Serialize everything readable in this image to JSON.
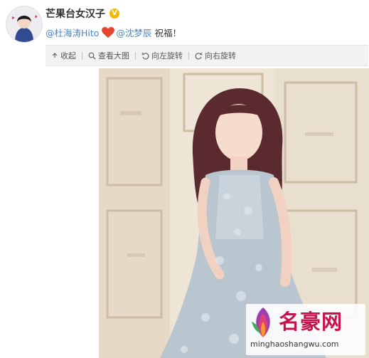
{
  "post": {
    "author": "芒果台女汉子",
    "verified_badge": "V",
    "mention1": "@杜海涛Hito",
    "mention2": "@沈梦辰",
    "message": "祝福！"
  },
  "toolbar": {
    "collapse": "收起",
    "view_large": "查看大图",
    "rotate_left": "向左旋转",
    "rotate_right": "向右旋转"
  },
  "watermark": {
    "name": "名豪网",
    "url": "minghaoshangwu.com"
  },
  "colors": {
    "link": "#4a86c5",
    "badge": "#f5b800",
    "heart": "#e8432e",
    "watermark": "#c8134f"
  }
}
